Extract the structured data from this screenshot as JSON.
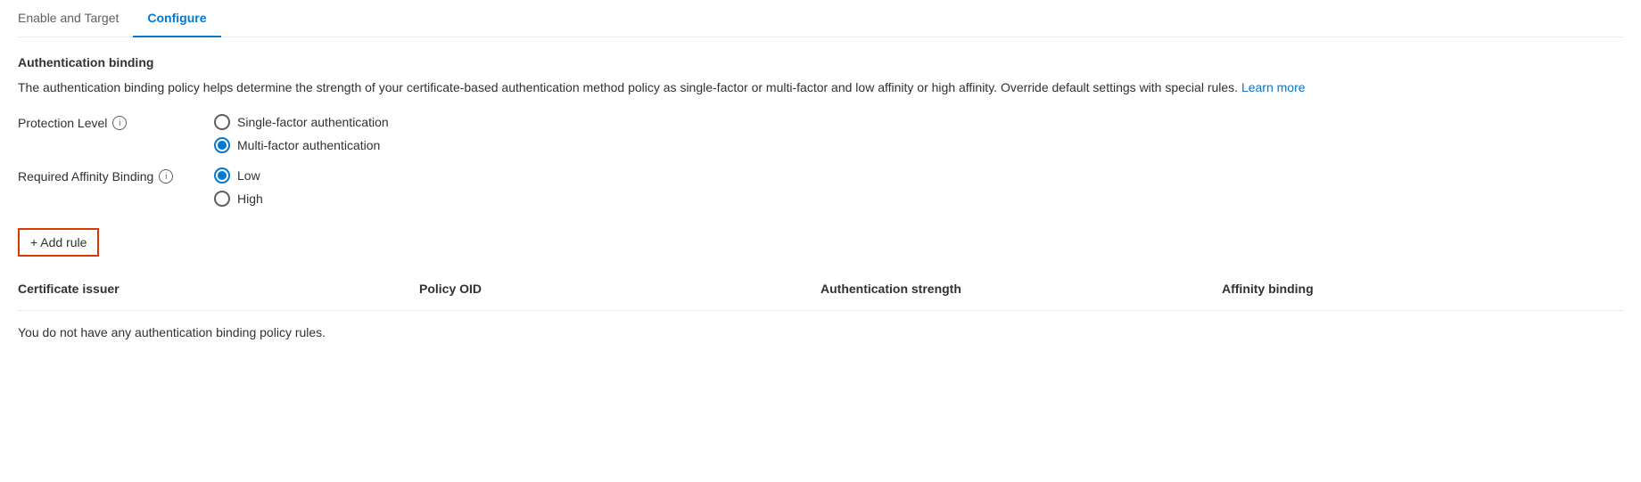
{
  "tabs": [
    {
      "id": "enable-target",
      "label": "Enable and Target",
      "active": false
    },
    {
      "id": "configure",
      "label": "Configure",
      "active": true
    }
  ],
  "section": {
    "title": "Authentication binding",
    "description": "The authentication binding policy helps determine the strength of your certificate-based authentication method policy as single-factor or multi-factor and low affinity or high affinity. Override default settings with special rules.",
    "learn_more_label": "Learn more"
  },
  "protection_level": {
    "label": "Protection Level",
    "options": [
      {
        "id": "single-factor",
        "label": "Single-factor authentication",
        "checked": false
      },
      {
        "id": "multi-factor",
        "label": "Multi-factor authentication",
        "checked": true
      }
    ]
  },
  "affinity_binding": {
    "label": "Required Affinity Binding",
    "options": [
      {
        "id": "low",
        "label": "Low",
        "checked": true
      },
      {
        "id": "high",
        "label": "High",
        "checked": false
      }
    ]
  },
  "add_rule_button": {
    "label": "+ Add rule"
  },
  "table": {
    "columns": [
      {
        "id": "certificate-issuer",
        "label": "Certificate issuer"
      },
      {
        "id": "policy-oid",
        "label": "Policy OID"
      },
      {
        "id": "authentication-strength",
        "label": "Authentication strength"
      },
      {
        "id": "affinity-binding",
        "label": "Affinity binding"
      }
    ],
    "empty_message": "You do not have any authentication binding policy rules."
  }
}
